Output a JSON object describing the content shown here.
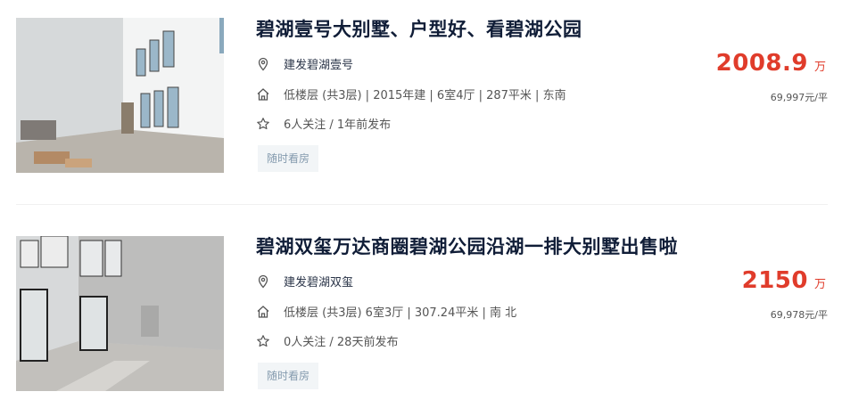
{
  "listings": [
    {
      "title": "碧湖壹号大别墅、户型好、看碧湖公园",
      "community": "建发碧湖壹号",
      "house_info": "低楼层 (共3层) | 2015年建 | 6室4厅 | 287平米 | 东南",
      "follow_info": "6人关注 / 1年前发布",
      "tag": "随时看房",
      "total_price": "2008.9",
      "price_unit": "万",
      "unit_price": "69,997元/平",
      "icons": [
        "location-icon",
        "house-icon",
        "star-icon"
      ]
    },
    {
      "title": "碧湖双玺万达商圈碧湖公园沿湖一排大别墅出售啦",
      "community": "建发碧湖双玺",
      "house_info": "低楼层 (共3层) 6室3厅 | 307.24平米 | 南 北",
      "follow_info": "0人关注 / 28天前发布",
      "tag": "随时看房",
      "total_price": "2150",
      "price_unit": "万",
      "unit_price": "69,978元/平",
      "icons": [
        "location-icon",
        "house-icon",
        "star-icon"
      ]
    }
  ],
  "colors": {
    "price": "#e03c2b",
    "title": "#101d37",
    "tag_bg": "#f2f5f7",
    "tag_text": "#849aae"
  }
}
